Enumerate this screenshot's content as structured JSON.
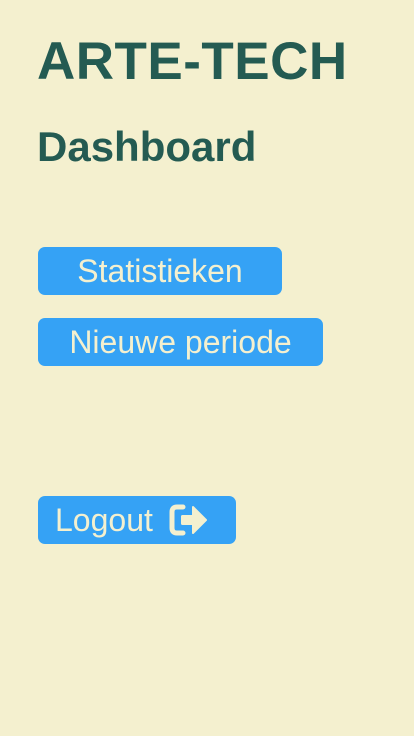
{
  "header": {
    "brand": "ARTE-TECH",
    "page_title": "Dashboard"
  },
  "menu": {
    "statistics_label": "Statistieken",
    "new_period_label": "Nieuwe periode",
    "logout_label": "Logout",
    "logout_icon": "sign-out-icon"
  },
  "colors": {
    "background": "#f4f0cf",
    "heading": "#245b52",
    "button": "#35a2f5",
    "button_text": "#f4f0cf"
  }
}
